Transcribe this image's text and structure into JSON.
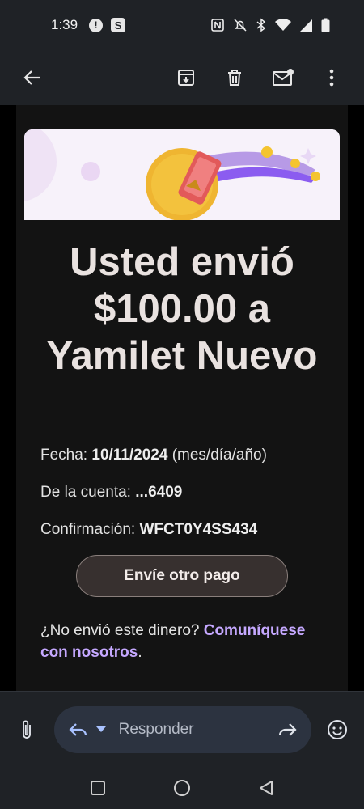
{
  "status_bar": {
    "time": "1:39",
    "notifications": [
      "alert-icon",
      "s-app-icon"
    ],
    "indicators": [
      "nfc-icon",
      "mute-icon",
      "bluetooth-icon",
      "wifi-icon",
      "signal-icon",
      "battery-icon"
    ]
  },
  "app_bar": {
    "actions": [
      "archive-icon",
      "delete-icon",
      "mark-unread-icon",
      "more-icon"
    ]
  },
  "email": {
    "headline_line1": "Usted envió",
    "headline_line2": "$100.00 a",
    "headline_line3": "Yamilet Nuevo",
    "date_label": "Fecha:",
    "date_value": "10/11/2024",
    "date_suffix": "(mes/día/año)",
    "account_label": "De la cuenta:",
    "account_value": "...6409",
    "confirmation_label": "Confirmación:",
    "confirmation_value": "WFCT0Y4SS434",
    "send_again_button": "Envíe otro pago",
    "footer_question": "¿No envió este dinero?",
    "footer_link": "Comuníquese con nosotros",
    "footer_period": ".",
    "colors": {
      "link": "#c5a8ff",
      "headline": "#e9e2e0"
    }
  },
  "reply_bar": {
    "placeholder": "Responder"
  }
}
